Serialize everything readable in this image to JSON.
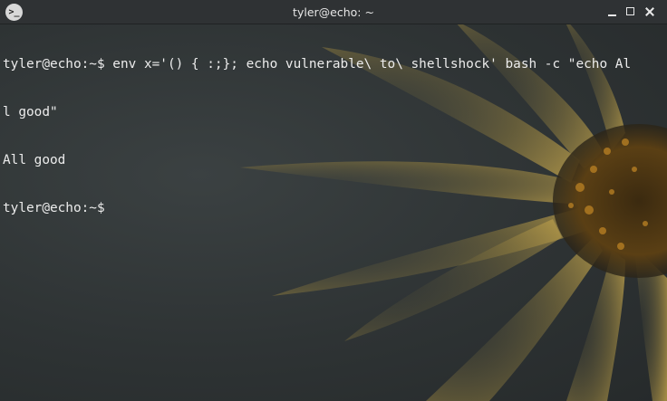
{
  "window": {
    "title": "tyler@echo: ~",
    "app_icon": {
      "name": "terminal-icon",
      "glyph": ">_"
    },
    "controls": [
      {
        "name": "minimize-icon"
      },
      {
        "name": "maximize-icon"
      },
      {
        "name": "close-icon"
      }
    ]
  },
  "terminal": {
    "lines": [
      "tyler@echo:~$ env x='() { :;}; echo vulnerable\\ to\\ shellshock' bash -c \"echo Al",
      "l good\"",
      "All good",
      "tyler@echo:~$ "
    ],
    "text_color": "#ececec",
    "background_color": "#2e3334",
    "wallpaper": "yellow flower petals"
  }
}
